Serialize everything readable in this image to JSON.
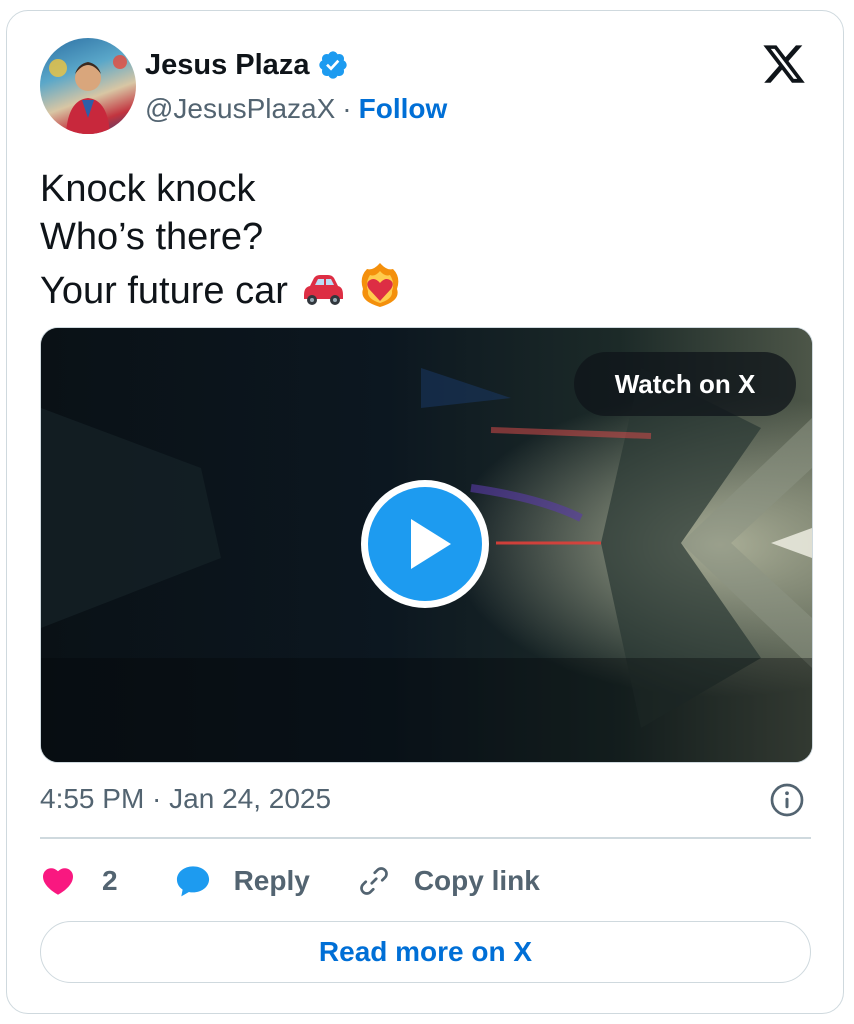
{
  "author": {
    "name": "Jesus Plaza",
    "handle": "@JesusPlazaX",
    "separator": "·",
    "follow_label": "Follow",
    "verified": true
  },
  "tweet": {
    "lines": [
      "Knock knock",
      "Who’s there?",
      "Your future car"
    ],
    "emojis": [
      "red-car-emoji",
      "heart-on-fire-emoji"
    ]
  },
  "media": {
    "watch_label": "Watch on X",
    "type": "video"
  },
  "timestamp": "4:55 PM · Jan 24, 2025",
  "actions": {
    "like_count": "2",
    "reply_label": "Reply",
    "copy_label": "Copy link"
  },
  "read_more_label": "Read more on X",
  "colors": {
    "link_blue": "#006fd6",
    "play_blue": "#1d9bf0",
    "like_pink": "#f91880",
    "text_primary": "#0f1419",
    "text_secondary": "#536471",
    "border": "#cfd9de"
  }
}
